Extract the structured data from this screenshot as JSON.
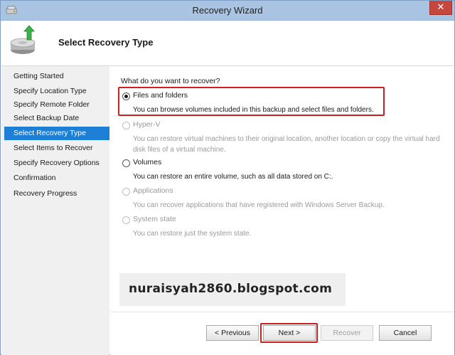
{
  "window": {
    "title": "Recovery Wizard",
    "close_glyph": "✕"
  },
  "header": {
    "heading": "Select Recovery Type",
    "icon": "backup-restore-icon"
  },
  "sidebar": {
    "items": [
      {
        "label": "Getting Started"
      },
      {
        "label": "Specify Location Type"
      },
      {
        "label": "Specify Remote Folder"
      },
      {
        "label": "Select Backup Date"
      },
      {
        "label": "Select Recovery Type",
        "active": true
      },
      {
        "label": "Select Items to Recover"
      },
      {
        "label": "Specify Recovery Options"
      },
      {
        "label": "Confirmation"
      },
      {
        "label": "Recovery Progress"
      }
    ]
  },
  "main": {
    "question": "What do you want to recover?",
    "options": [
      {
        "label": "Files and folders",
        "desc": "You can browse volumes included in this backup and select files and folders.",
        "selected": true,
        "enabled": true
      },
      {
        "label": "Hyper-V",
        "desc": "You can restore virtual machines to their original location, another location or copy the virtual hard disk files of a virtual machine.",
        "selected": false,
        "enabled": false
      },
      {
        "label": "Volumes",
        "desc": "You can restore an entire volume, such as all data stored on C:.",
        "selected": false,
        "enabled": true
      },
      {
        "label": "Applications",
        "desc": "You can recover applications that have registered with Windows Server Backup.",
        "selected": false,
        "enabled": false
      },
      {
        "label": "System state",
        "desc": "You can restore just the system state.",
        "selected": false,
        "enabled": false
      }
    ]
  },
  "watermark": "nuraisyah2860.blogspot.com",
  "buttons": {
    "previous": "< Previous",
    "next": "Next >",
    "recover": "Recover",
    "cancel": "Cancel"
  },
  "colors": {
    "titlebar": "#a9c3e3",
    "active_nav": "#1e7fd6",
    "highlight": "#cc1f1f",
    "close": "#c7473c"
  }
}
